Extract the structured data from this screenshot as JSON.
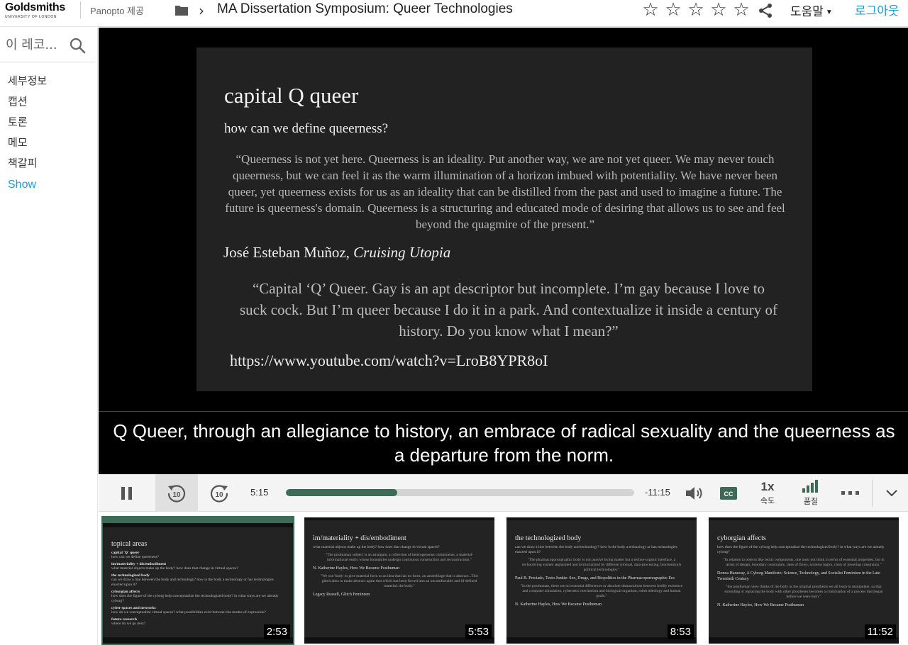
{
  "header": {
    "logo_name": "Goldsmiths",
    "logo_sub": "UNIVERSITY OF LONDON",
    "provided_by": "Panopto 제공",
    "title": "MA Dissertation Symposium: Queer Technologies",
    "rating_stars": [
      "☆",
      "☆",
      "☆",
      "☆",
      "☆"
    ],
    "help_label": "도움말",
    "logout_label": "로그아웃"
  },
  "sidebar": {
    "search_placeholder": "이 레코...",
    "items": [
      {
        "label": "세부정보"
      },
      {
        "label": "캡션"
      },
      {
        "label": "토론"
      },
      {
        "label": "메모"
      },
      {
        "label": "책갈피"
      }
    ],
    "show_label": "Show"
  },
  "slide": {
    "title": "capital Q queer",
    "subtitle": "how can we define queerness?",
    "quote1": "“Queerness is not yet here. Queerness is an ideality. Put another way, we are not yet queer. We may never touch queerness, but we can feel it as the warm illumination of a horizon imbued with potentiality. We have never been queer, yet queerness exists for us as an ideality that can be distilled from the past and used to imagine a future. The future is queerness's domain. Queerness is a structuring and educated mode of desiring that allows us to see and feel beyond the quagmire of the present.”",
    "attr1_author": "José Esteban Muñoz, ",
    "attr1_work": "Cruising Utopia",
    "quote2": "“Capital ‘Q’ Queer. Gay is an apt descriptor but incomplete. I’m gay because I love to suck cock. But I’m queer because I do it in a park. And contextualize it inside a century of history. Do you know what I mean?”",
    "url": "https://www.youtube.com/watch?v=LroB8YPR8oI"
  },
  "caption": "Q Queer, through an allegiance to history, an embrace of radical sexuality and the queerness as a departure from the norm.",
  "controls": {
    "current_time": "5:15",
    "remaining_time": "-11:15",
    "progress_fraction": 0.32,
    "rewind_label": "10",
    "forward_label": "10",
    "cc_label": "CC",
    "speed_value": "1x",
    "speed_label": "속도",
    "quality_label": "품질",
    "accent_color": "#3d6b57"
  },
  "thumbnails": [
    {
      "title": "topical areas",
      "duration": "2:53",
      "active": true,
      "lines": [
        {
          "h": "capital 'Q' queer",
          "t": "how can we define queerness?"
        },
        {
          "h": "im/materiality + dis/embodiment",
          "t": "what material objects make up the body? how does that change in virtual spaces?"
        },
        {
          "h": "the technologized body",
          "t": "can we draw a line between the body and technology? how is the body a technology or has technologies enacted upon it?"
        },
        {
          "h": "cyborgian affects",
          "t": "how does the figure of the cyborg help conceptualize the technologized body? in what ways are we already cyborg?"
        },
        {
          "h": "cyber spaces and networks",
          "t": "how do we conceptualize virtual spaces? what possibilities exist between the modes of expression?"
        },
        {
          "h": "future research",
          "t": "where do we go next?"
        }
      ]
    },
    {
      "title": "im/materiality + dis/embodiment",
      "duration": "5:53",
      "sub": "what material objects make up the body? how does that change in virtual spaces?",
      "quote_a": "\"The posthuman subject is an amalgam, a collection of heterogeneous components, a material-informational entity whose boundaries undergo continuous construction and reconstruction.\"",
      "attr_a": "N. Katherine Hayles, How We Became Posthuman",
      "quote_b": "\"We use 'body' to give material form to an idea that has no form, an assemblage that is abstract...This glitch aims to make abstract again that which has been forced into an uncomfortable and ill-defined material: the body.\"",
      "attr_b": "Legacy Russell, Glitch Feminism"
    },
    {
      "title": "the technologized body",
      "duration": "8:53",
      "sub": "can we draw a line between the body and technology? how is the body a technology or has technologies enacted upon it?",
      "quote_a": "\"The pharmacopornographic body is not passive living matter but a techno-organic interface, a technoliving system segmented and territorialized by different (textual, data-processing, biochemical) political technologies.\"",
      "attr_a": "Paul B. Preciado, Testo Junkie: Sex, Drugs, and Biopolitics in the Pharmacopornographic Era",
      "quote_b": "\"In the posthuman, there are no essential differences or absolute demarcations between bodily existence and computer simulation, cybernetic mechanism and biological organism, robot teleology and human goals.\"",
      "attr_b": "N. Katherine Hayles, How We Became Posthuman"
    },
    {
      "title": "cyborgian affects",
      "duration": "11:52",
      "sub": "how does the figure of the cyborg help conceptualize the technologized body? in what ways are we already cyborg?",
      "quote_a": "\"In relation to objects like biotic components, one must not think in terms of essential properties, but in terms of design, boundary constraints, rates of flows, systems logics, costs of lowering constraints.\"",
      "attr_a": "Donna Haraway, A Cyborg Manifesto: Science, Technology, and Socialist Feminism in the Late Twentieth Century",
      "quote_b": "\"the posthuman view thinks of the body as the original prosthesis we all learn to manipulate, so that extending or replacing the body with other prostheses becomes a continuation of a process that began before we were born.\"",
      "attr_b": "N. Katherine Hayles, How We Became Posthuman"
    }
  ]
}
